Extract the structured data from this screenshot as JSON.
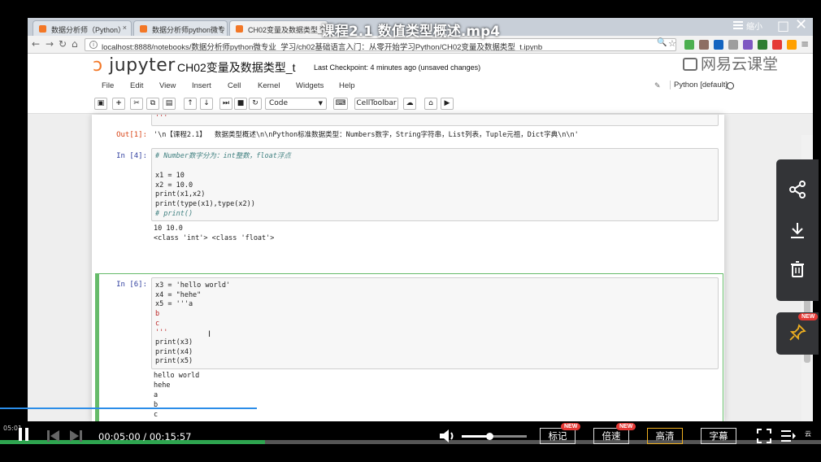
{
  "video": {
    "title": "课程2.1 数值类型概述.mp4",
    "window_controls": [
      "☰",
      "缩小",
      "□",
      "✕"
    ]
  },
  "browser": {
    "tabs": [
      {
        "label": "数据分析师（Python）"
      },
      {
        "label": "数据分析师python微专"
      },
      {
        "label": "CH02变量及数据类型_t"
      }
    ],
    "url": "localhost:8888/notebooks/数据分析师python微专业_学习/ch02基础语言入门：从零开始学习Python/CH02变量及数据类型_t.ipynb"
  },
  "jupyter": {
    "logo_text": "jupyter",
    "notebook_name": "CH02变量及数据类型_t",
    "checkpoint": "Last Checkpoint: 4 minutes ago (unsaved changes)",
    "menus": [
      "File",
      "Edit",
      "View",
      "Insert",
      "Cell",
      "Kernel",
      "Widgets",
      "Help"
    ],
    "kernel": "Python [default]",
    "cell_type": "Code",
    "celltoolbar_label": "CellToolbar"
  },
  "watermark": "网易云课堂",
  "cells": {
    "top_tail": "'''",
    "out1_prompt": "Out[1]:",
    "out1_text": "'\\n【课程2.1】  数据类型概述\\n\\nPython标准数据类型：Numbers数字，String字符串，List列表，Tuple元祖，Dict字典\\n\\n'",
    "in4_prompt": "In  [4]:",
    "in4_comment": "# Number数字分为：int整数，float浮点",
    "in4_code": [
      "x1 = 10",
      "x2 = 10.0",
      "print(x1,x2)",
      "print(type(x1),type(x2))",
      "# print()"
    ],
    "in4_output": [
      "10 10.0",
      "<class 'int'> <class 'float'>"
    ],
    "in6_prompt": "In  [6]:",
    "in6_code": [
      "x3 = 'hello world'",
      "x4 = \"hehe\"",
      "x5 = '''a",
      "b",
      "c",
      "'''",
      "print(x3)",
      "print(x4)",
      "print(x5)"
    ],
    "in6_output": [
      "hello world",
      "hehe",
      "a",
      "b",
      "c"
    ]
  },
  "side_panel": {
    "icons": [
      "share-icon",
      "download-icon",
      "delete-icon",
      "pin-icon"
    ],
    "badge": "NEW"
  },
  "player": {
    "current_time": "00:05:00",
    "total_time": "00:15:57",
    "time_display": "00:05:00 / 00:15:57",
    "preview_time": "05:01",
    "progress_fraction": 0.323,
    "buffer_fraction": 0.313,
    "volume_fraction": 0.42,
    "buttons": {
      "mark": "标记",
      "speed": "倍速",
      "quality": "高清",
      "subtitle": "字幕"
    },
    "new_badge": "NEW",
    "brand_corner": "云"
  },
  "colors": {
    "jupyter_orange": "#f37726",
    "selected_cell_border": "#66bb6a",
    "progress": "#2ea44f",
    "quality_border": "#f0b020"
  }
}
